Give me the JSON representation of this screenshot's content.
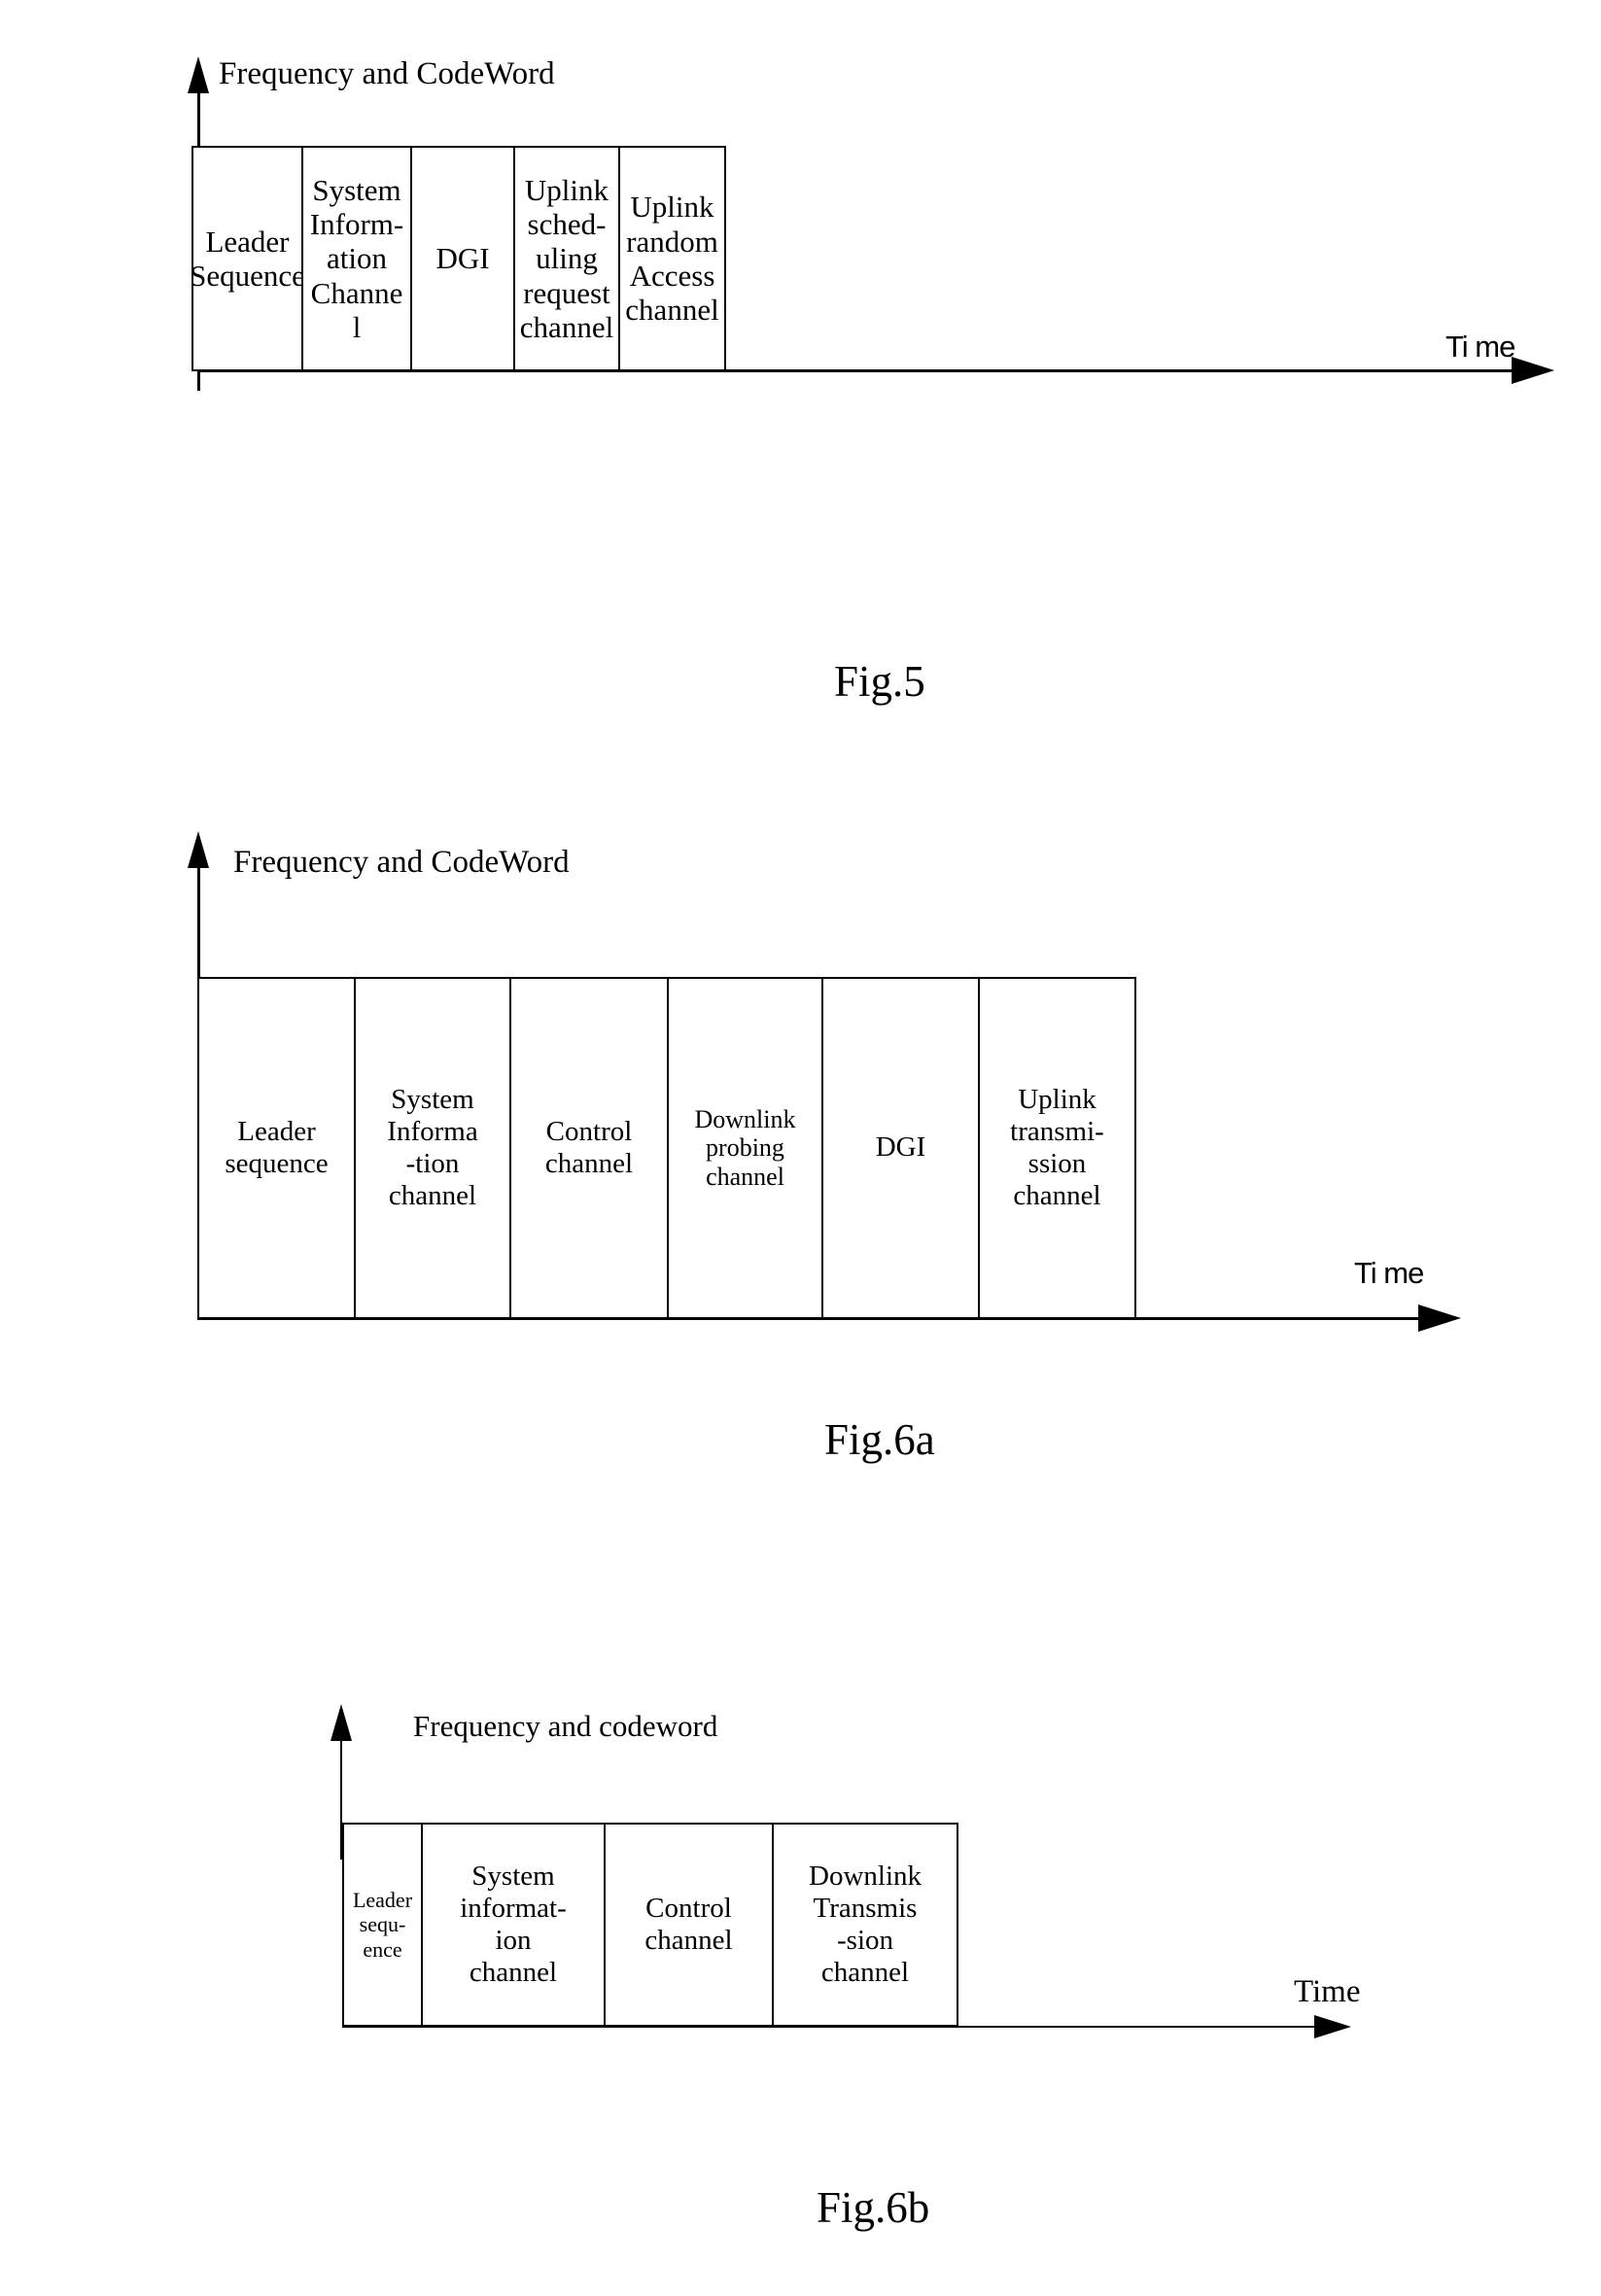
{
  "figures": [
    {
      "id": "fig5",
      "caption": "Fig.5",
      "y_axis_label": "Frequency and CodeWord",
      "x_axis_label": "Ti me",
      "blocks": [
        {
          "label": "Leader\nSequence"
        },
        {
          "label": "System\nInform-\nation\nChanne\nl"
        },
        {
          "label": "DGI"
        },
        {
          "label": "Uplink\nsched-\nuling\nrequest\nchannel"
        },
        {
          "label": "Uplink\nrandom\nAccess\nchannel"
        }
      ]
    },
    {
      "id": "fig6a",
      "caption": "Fig.6a",
      "y_axis_label": "Frequency and CodeWord",
      "x_axis_label": "Ti me",
      "blocks": [
        {
          "label": "Leader\nsequence"
        },
        {
          "label": "System\nInforma\n-tion\nchannel"
        },
        {
          "label": "Control\nchannel"
        },
        {
          "label": "Downlink\nprobing\nchannel"
        },
        {
          "label": "DGI"
        },
        {
          "label": "Uplink\ntransmi-\nssion\nchannel"
        }
      ]
    },
    {
      "id": "fig6b",
      "caption": "Fig.6b",
      "y_axis_label": "Frequency and codeword",
      "x_axis_label": "Time",
      "blocks": [
        {
          "label": "Leader\nsequ-\nence"
        },
        {
          "label": "System\ninformat-\nion\nchannel"
        },
        {
          "label": "Control\nchannel"
        },
        {
          "label": "Downlink\nTransmis\n-sion\nchannel"
        }
      ]
    }
  ],
  "colors": {
    "ink": "#000000",
    "paper": "#ffffff"
  }
}
